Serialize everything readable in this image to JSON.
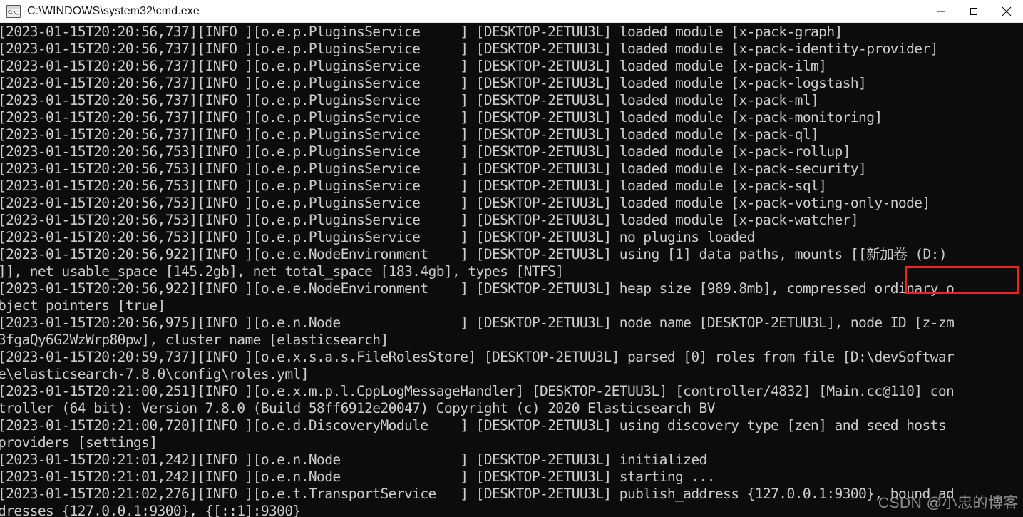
{
  "window": {
    "title": "C:\\WINDOWS\\system32\\cmd.exe",
    "icon": "cmd-icon",
    "controls": {
      "minimize": "minimize-button",
      "maximize": "maximize-button",
      "close": "close-button"
    }
  },
  "console": {
    "background_color": "#0c0c0c",
    "foreground_color": "#cccccc",
    "lines": [
      "[2023-01-15T20:20:56,737][INFO ][o.e.p.PluginsService     ] [DESKTOP-2ETUU3L] loaded module [x-pack-graph]",
      "[2023-01-15T20:20:56,737][INFO ][o.e.p.PluginsService     ] [DESKTOP-2ETUU3L] loaded module [x-pack-identity-provider]",
      "[2023-01-15T20:20:56,737][INFO ][o.e.p.PluginsService     ] [DESKTOP-2ETUU3L] loaded module [x-pack-ilm]",
      "[2023-01-15T20:20:56,737][INFO ][o.e.p.PluginsService     ] [DESKTOP-2ETUU3L] loaded module [x-pack-logstash]",
      "[2023-01-15T20:20:56,737][INFO ][o.e.p.PluginsService     ] [DESKTOP-2ETUU3L] loaded module [x-pack-ml]",
      "[2023-01-15T20:20:56,737][INFO ][o.e.p.PluginsService     ] [DESKTOP-2ETUU3L] loaded module [x-pack-monitoring]",
      "[2023-01-15T20:20:56,737][INFO ][o.e.p.PluginsService     ] [DESKTOP-2ETUU3L] loaded module [x-pack-ql]",
      "[2023-01-15T20:20:56,753][INFO ][o.e.p.PluginsService     ] [DESKTOP-2ETUU3L] loaded module [x-pack-rollup]",
      "[2023-01-15T20:20:56,753][INFO ][o.e.p.PluginsService     ] [DESKTOP-2ETUU3L] loaded module [x-pack-security]",
      "[2023-01-15T20:20:56,753][INFO ][o.e.p.PluginsService     ] [DESKTOP-2ETUU3L] loaded module [x-pack-sql]",
      "[2023-01-15T20:20:56,753][INFO ][o.e.p.PluginsService     ] [DESKTOP-2ETUU3L] loaded module [x-pack-voting-only-node]",
      "[2023-01-15T20:20:56,753][INFO ][o.e.p.PluginsService     ] [DESKTOP-2ETUU3L] loaded module [x-pack-watcher]",
      "[2023-01-15T20:20:56,753][INFO ][o.e.p.PluginsService     ] [DESKTOP-2ETUU3L] no plugins loaded",
      "[2023-01-15T20:20:56,922][INFO ][o.e.e.NodeEnvironment    ] [DESKTOP-2ETUU3L] using [1] data paths, mounts [[新加卷 (D:)",
      "]], net usable_space [145.2gb], net total_space [183.4gb], types [NTFS]",
      "[2023-01-15T20:20:56,922][INFO ][o.e.e.NodeEnvironment    ] [DESKTOP-2ETUU3L] heap size [989.8mb], compressed ordinary o",
      "bject pointers [true]",
      "[2023-01-15T20:20:56,975][INFO ][o.e.n.Node               ] [DESKTOP-2ETUU3L] node name [DESKTOP-2ETUU3L], node ID [z-zm",
      "3fgaQy6G2WzWrp80pw], cluster name [elasticsearch]",
      "[2023-01-15T20:20:59,737][INFO ][o.e.x.s.a.s.FileRolesStore] [DESKTOP-2ETUU3L] parsed [0] roles from file [D:\\devSoftwar",
      "e\\elasticsearch-7.8.0\\config\\roles.yml]",
      "[2023-01-15T20:21:00,251][INFO ][o.e.x.m.p.l.CppLogMessageHandler] [DESKTOP-2ETUU3L] [controller/4832] [Main.cc@110] con",
      "troller (64 bit): Version 7.8.0 (Build 58ff6912e20047) Copyright (c) 2020 Elasticsearch BV",
      "[2023-01-15T20:21:00,720][INFO ][o.e.d.DiscoveryModule    ] [DESKTOP-2ETUU3L] using discovery type [zen] and seed hosts ",
      "providers [settings]",
      "[2023-01-15T20:21:01,242][INFO ][o.e.n.Node               ] [DESKTOP-2ETUU3L] initialized",
      "[2023-01-15T20:21:01,242][INFO ][o.e.n.Node               ] [DESKTOP-2ETUU3L] starting ...",
      "[2023-01-15T20:21:02,276][INFO ][o.e.t.TransportService   ] [DESKTOP-2ETUU3L] publish_address {127.0.0.1:9300}, bound_ad",
      "dresses {127.0.0.1:9300}, {[::1]:9300}"
    ]
  },
  "annotation": {
    "highlight_box": {
      "name": "red-highlight-box",
      "color": "#ee2222",
      "target_text": "[[新加卷 (D:)"
    }
  },
  "watermark": {
    "text": "CSDN @小忠的博客"
  }
}
